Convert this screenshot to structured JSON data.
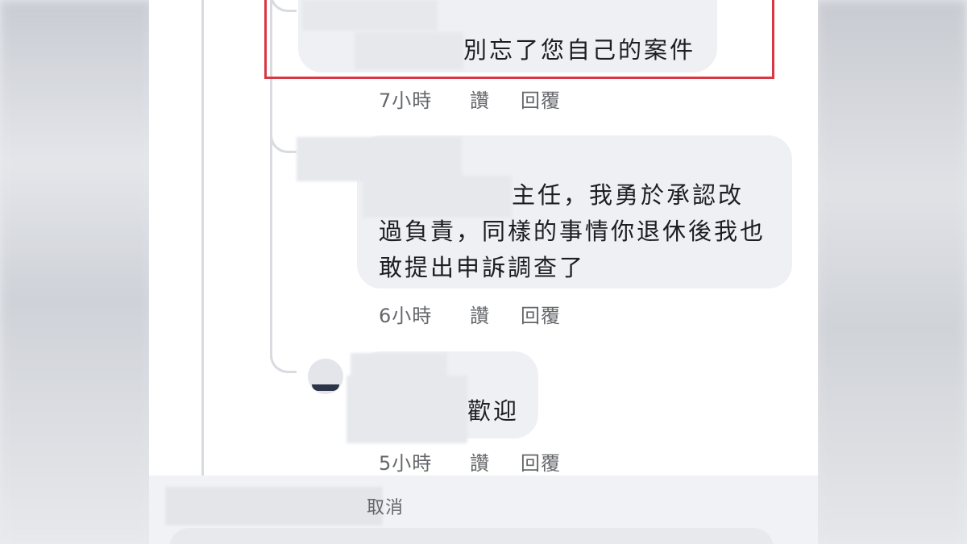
{
  "comments": [
    {
      "text": "別忘了您自己的案件",
      "time": "7小時",
      "like_label": "讚",
      "reply_label": "回覆"
    },
    {
      "text": "主任，我勇於承認改\n過負責，同樣的事情你退休後我也\n敢提出申訴調查了",
      "time": "6小時",
      "like_label": "讚",
      "reply_label": "回覆"
    },
    {
      "text": "歡迎",
      "time": "5小時",
      "like_label": "讚",
      "reply_label": "回覆"
    }
  ],
  "composer": {
    "cancel_label": "取消"
  },
  "colors": {
    "highlight_border": "#d93843",
    "bubble": "#eef0f4",
    "meta_text": "#65676b"
  }
}
